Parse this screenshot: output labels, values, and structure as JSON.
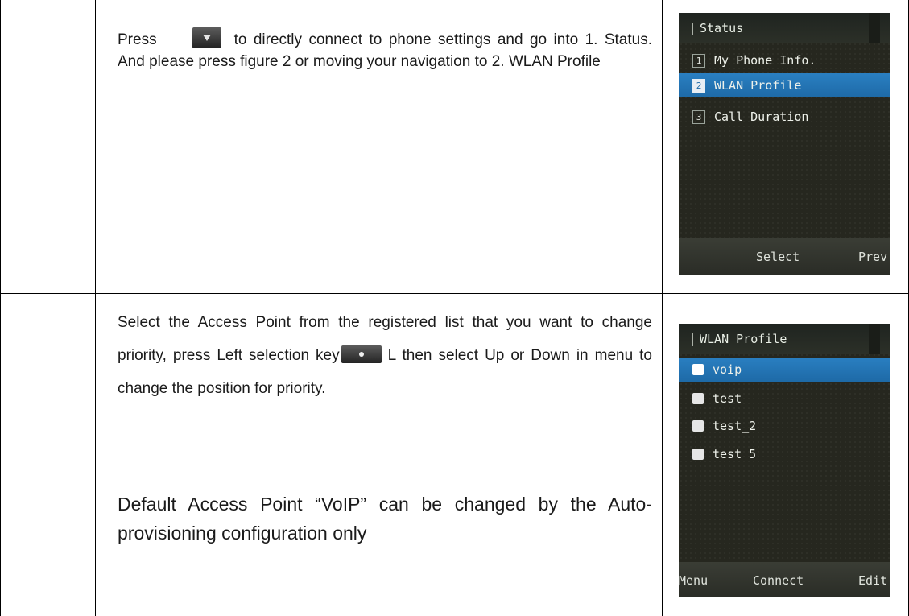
{
  "row1": {
    "press_word": "Press",
    "instruction_rest": "to directly connect to phone settings and go into 1. Status. And please press figure 2 or moving your navigation to 2. WLAN Profile"
  },
  "row2": {
    "instruction_part1": "Select the Access Point from the registered list that you want to change priority, press Left selection key",
    "instruction_key_letter": "L",
    "instruction_part2": "then select Up or Down in menu to change the position for priority.",
    "note": "Default Access Point “VoIP” can be changed by the Auto- provisioning configuration only"
  },
  "screen1": {
    "title": "Status",
    "items": [
      {
        "num": "1",
        "label": "My Phone Info."
      },
      {
        "num": "2",
        "label": "WLAN Profile"
      },
      {
        "num": "3",
        "label": "Call Duration"
      }
    ],
    "selected_index": 1,
    "softkeys": {
      "center": "Select",
      "right": "Prev"
    }
  },
  "screen2": {
    "title": "WLAN Profile",
    "items": [
      {
        "label": "voip"
      },
      {
        "label": "test"
      },
      {
        "label": "test_2"
      },
      {
        "label": "test_5"
      }
    ],
    "selected_index": 0,
    "softkeys": {
      "left": "Menu",
      "center": "Connect",
      "right": "Edit"
    }
  },
  "icons": {
    "down_key": "navigation-down-key-icon",
    "left_key": "left-selection-key-icon"
  },
  "colors": {
    "highlight": "#1e6aa7",
    "screen_bg": "#26271f"
  }
}
